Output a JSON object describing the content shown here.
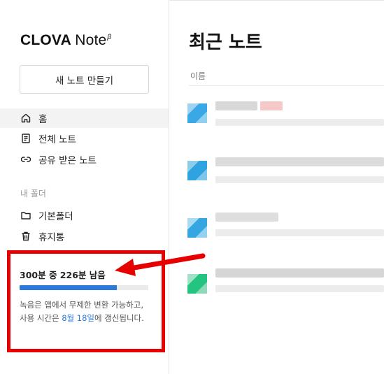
{
  "brand": {
    "name": "CLOVA",
    "product": "Note",
    "badge": "β"
  },
  "sidebar": {
    "new_note_label": "새 노트 만들기",
    "nav": [
      {
        "label": "홈",
        "icon": "home-icon",
        "active": true
      },
      {
        "label": "전체 노트",
        "icon": "document-icon",
        "active": false
      },
      {
        "label": "공유 받은 노트",
        "icon": "link-icon",
        "active": false
      }
    ],
    "folders_label": "내 폴더",
    "folders": [
      {
        "label": "기본폴더",
        "icon": "folder-icon"
      },
      {
        "label": "휴지통",
        "icon": "trash-icon"
      }
    ]
  },
  "usage": {
    "title": "300분 중 226분 남음",
    "fraction_remaining": 0.753,
    "desc_before": "녹음은 앱에서 무제한 변환 가능하고, 사용 시간은 ",
    "desc_date": "8월 18일",
    "desc_after": "에 갱신됩니다."
  },
  "main": {
    "title": "최근 노트",
    "column_name": "이름"
  },
  "colors": {
    "accent": "#2b7ad9",
    "annotation": "#e60000"
  }
}
